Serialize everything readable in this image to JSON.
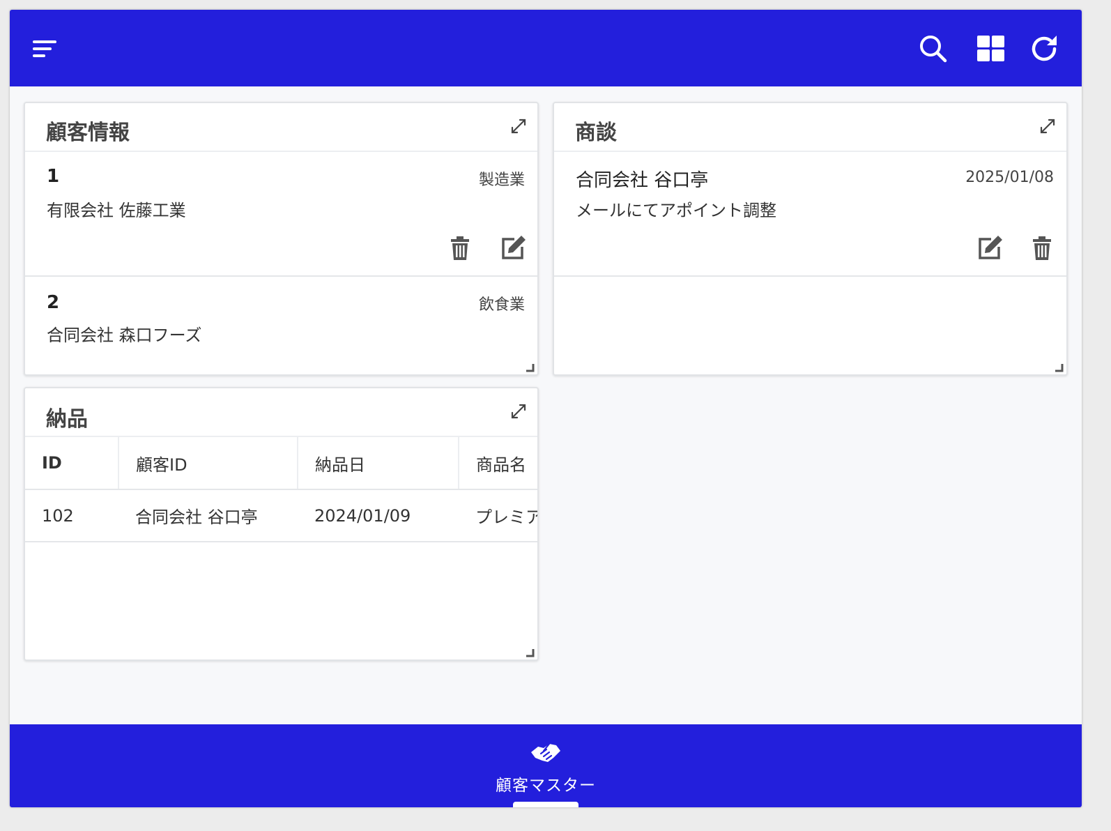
{
  "header": {
    "menu_icon": "menu-icon",
    "actions": [
      "search-icon",
      "grid-icon",
      "refresh-icon"
    ],
    "color": "#231fdc"
  },
  "customer_card": {
    "title": "顧客情報",
    "items": [
      {
        "id": "1",
        "name": "有限会社 佐藤工業",
        "industry": "製造業"
      },
      {
        "id": "2",
        "name": "合同会社 森口フーズ",
        "industry": "飲食業"
      }
    ]
  },
  "deals_card": {
    "title": "商談",
    "items": [
      {
        "company": "合同会社 谷口亭",
        "date": "2025/01/08",
        "note": "メールにてアポイント調整"
      }
    ]
  },
  "delivery_card": {
    "title": "納品",
    "columns": [
      "ID",
      "顧客ID",
      "納品日",
      "商品名"
    ],
    "rows": [
      {
        "id": "102",
        "customer": "合同会社 谷口亭",
        "date": "2024/01/09",
        "product": "プレミア"
      }
    ]
  },
  "footer": {
    "icon": "handshake-icon",
    "label": "顧客マスター"
  }
}
